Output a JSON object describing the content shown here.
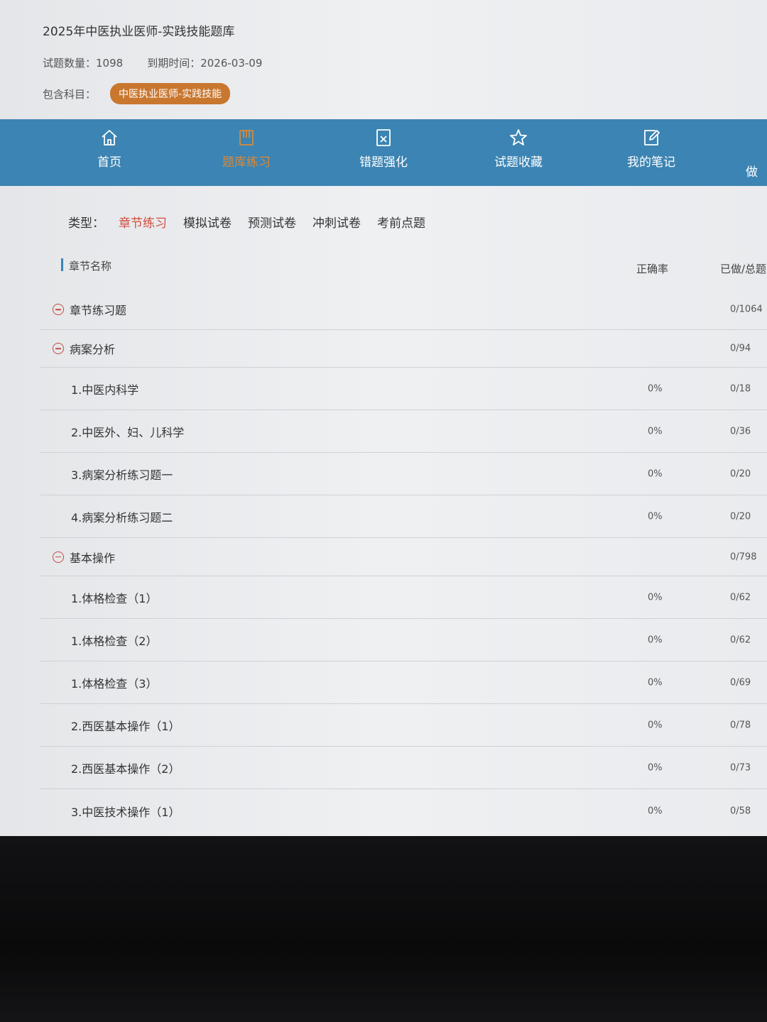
{
  "header": {
    "title": "2025年中医执业医师-实践技能题库",
    "count_label": "试题数量：",
    "count_value": "1098",
    "expire_label": "到期时间：",
    "expire_value": "2026-03-09",
    "subject_label": "包含科目：",
    "subject_value": "中医执业医师-实践技能"
  },
  "nav": {
    "items": [
      {
        "label": "首页",
        "icon": "home-icon"
      },
      {
        "label": "题库练习",
        "icon": "book-icon"
      },
      {
        "label": "错题强化",
        "icon": "wrong-questions-icon"
      },
      {
        "label": "试题收藏",
        "icon": "star-icon"
      },
      {
        "label": "我的笔记",
        "icon": "note-edit-icon"
      },
      {
        "label": "做"
      }
    ],
    "active_color": "#d98a3a",
    "bar_color": "#3c84b3"
  },
  "filter": {
    "label": "类型：",
    "items": [
      "章节练习",
      "模拟试卷",
      "预测试卷",
      "冲刺试卷",
      "考前点题"
    ],
    "active_color": "#d24c3c"
  },
  "table": {
    "headers": {
      "name": "章节名称",
      "rate": "正确率",
      "done": "已做/总题"
    },
    "rows": [
      {
        "name": "章节练习题",
        "rate": "",
        "done": "0/1064"
      },
      {
        "name": "病案分析",
        "rate": "",
        "done": "0/94"
      },
      {
        "name": "1.中医内科学",
        "rate": "0%",
        "done": "0/18"
      },
      {
        "name": "2.中医外、妇、儿科学",
        "rate": "0%",
        "done": "0/36"
      },
      {
        "name": "3.病案分析练习题一",
        "rate": "0%",
        "done": "0/20"
      },
      {
        "name": "4.病案分析练习题二",
        "rate": "0%",
        "done": "0/20"
      },
      {
        "name": "基本操作",
        "rate": "",
        "done": "0/798"
      },
      {
        "name": "1.体格检查（1）",
        "rate": "0%",
        "done": "0/62"
      },
      {
        "name": "1.体格检查（2）",
        "rate": "0%",
        "done": "0/62"
      },
      {
        "name": "1.体格检查（3）",
        "rate": "0%",
        "done": "0/69"
      },
      {
        "name": "2.西医基本操作（1）",
        "rate": "0%",
        "done": "0/78"
      },
      {
        "name": "2.西医基本操作（2）",
        "rate": "0%",
        "done": "0/73"
      },
      {
        "name": "3.中医技术操作（1）",
        "rate": "0%",
        "done": "0/58"
      }
    ]
  }
}
